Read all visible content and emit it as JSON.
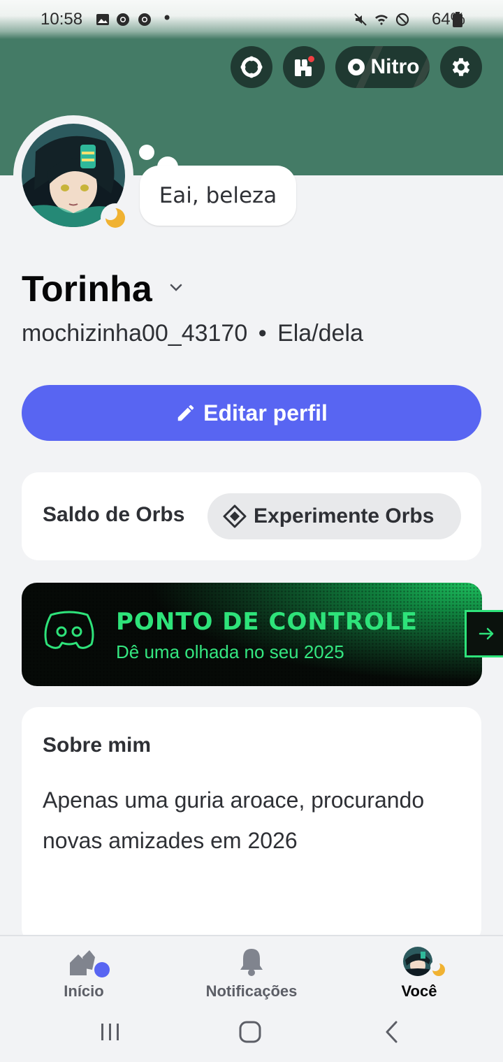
{
  "status_bar": {
    "time": "10:58",
    "battery": "64%",
    "dot": "•"
  },
  "header": {
    "nitro_label": "Nitro",
    "icons": [
      "quests-icon",
      "shop-icon",
      "nitro-icon",
      "gear-icon"
    ]
  },
  "profile": {
    "status_bubble": "Eai, beleza",
    "display_name": "Torinha",
    "username": "mochizinha00_43170",
    "separator": "•",
    "pronouns": "Ela/dela",
    "presence": "idle"
  },
  "actions": {
    "edit_profile": "Editar perfil"
  },
  "orbs": {
    "title": "Saldo de Orbs",
    "button": "Experimente Orbs"
  },
  "checkpoint": {
    "title": "PONTO DE CONTROLE",
    "subtitle": "Dê uma olhada no seu 2025"
  },
  "about": {
    "title": "Sobre mim",
    "text": "Apenas uma guria aroace, procurando novas amizades em 2026"
  },
  "bottom_nav": {
    "home": "Início",
    "notifications": "Notificações",
    "you": "Você"
  },
  "colors": {
    "banner": "#447b66",
    "accent": "#5865f2",
    "checkpoint_green": "#2ee37a",
    "idle": "#f0b232"
  }
}
